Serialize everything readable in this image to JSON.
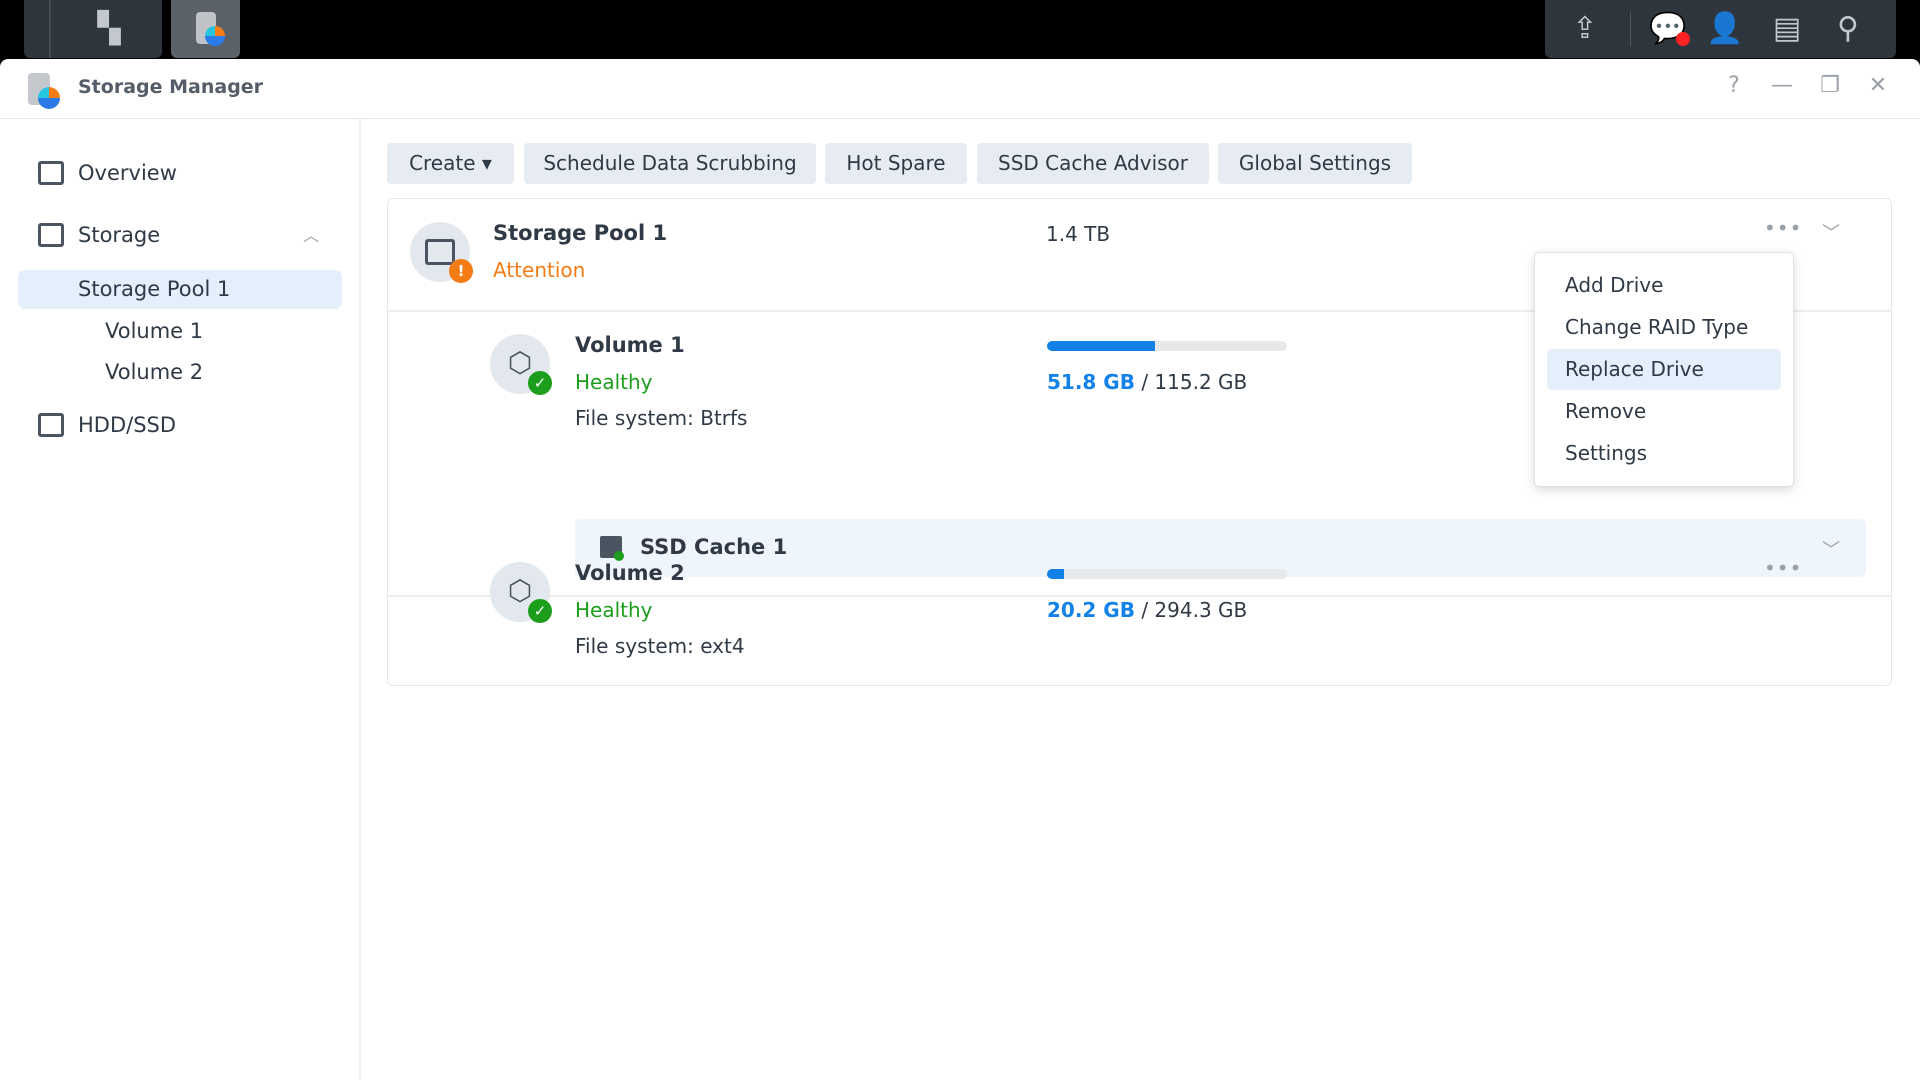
{
  "window": {
    "title": "Storage Manager",
    "help": "?",
    "minimize": "—",
    "restore": "❐",
    "close": "✕"
  },
  "sidebar": {
    "overview": "Overview",
    "storage": "Storage",
    "pool": "Storage Pool 1",
    "vol1": "Volume 1",
    "vol2": "Volume 2",
    "hdd": "HDD/SSD"
  },
  "toolbar": {
    "create": "Create ▾",
    "scrub": "Schedule Data Scrubbing",
    "hotspare": "Hot Spare",
    "advisor": "SSD Cache Advisor",
    "global": "Global Settings"
  },
  "pool": {
    "name": "Storage Pool 1",
    "status": "Attention",
    "size": "1.4 TB"
  },
  "volumes": [
    {
      "name": "Volume 1",
      "status": "Healthy",
      "fs": "File system: Btrfs",
      "used": "51.8 GB",
      "sep": " / ",
      "total": "115.2 GB",
      "usage_pct": 45
    },
    {
      "name": "Volume 2",
      "status": "Healthy",
      "fs": "File system: ext4",
      "used": "20.2 GB",
      "sep": " / ",
      "total": "294.3 GB",
      "usage_pct": 6.9
    }
  ],
  "cache": {
    "name": "SSD Cache 1"
  },
  "menu": [
    "Add Drive",
    "Change RAID Type",
    "Replace Drive",
    "Remove",
    "Settings"
  ],
  "colors": {
    "accent": "#1282e8",
    "attention": "#f57c14",
    "healthy": "#1c9e1c"
  }
}
